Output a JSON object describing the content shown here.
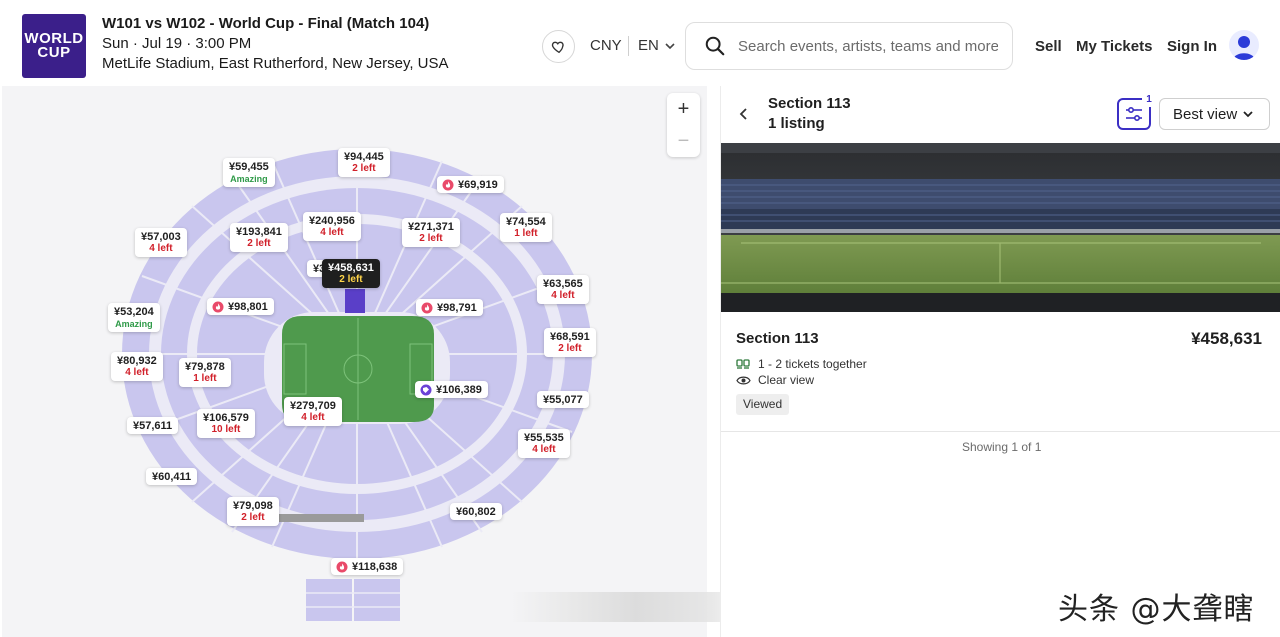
{
  "event": {
    "title": "W101 vs W102 - World Cup - Final (Match 104)",
    "datetime": "Sun · Jul 19 · 3:00 PM",
    "venue": "MetLife Stadium, East Rutherford, New Jersey, USA",
    "logo_line1": "WORLD",
    "logo_line2": "CUP"
  },
  "header": {
    "currency": "CNY",
    "language": "EN",
    "search_placeholder": "Search events, artists, teams and more",
    "nav": {
      "sell": "Sell",
      "my_tickets": "My Tickets",
      "sign_in": "Sign In"
    }
  },
  "map": {
    "zoom_in": "+",
    "zoom_out": "−",
    "pins": [
      {
        "price": "¥59,455",
        "sub": "Amazing"
      },
      {
        "price": "¥94,445",
        "sub": "2 left"
      },
      {
        "price": "¥69,919",
        "sub": ""
      },
      {
        "price": "¥240,956",
        "sub": "4 left"
      },
      {
        "price": "¥193,841",
        "sub": "2 left"
      },
      {
        "price": "¥57,003",
        "sub": "4 left"
      },
      {
        "price": "¥271,371",
        "sub": "2 left"
      },
      {
        "price": "¥74,554",
        "sub": "1 left"
      },
      {
        "price": "¥458,631",
        "sub": "2 left"
      },
      {
        "price": "¥63,565",
        "sub": "4 left"
      },
      {
        "price": "¥98,801",
        "sub": ""
      },
      {
        "price": "¥98,791",
        "sub": ""
      },
      {
        "price": "¥53,204",
        "sub": "Amazing"
      },
      {
        "price": "¥68,591",
        "sub": "2 left"
      },
      {
        "price": "¥80,932",
        "sub": "4 left"
      },
      {
        "price": "¥79,878",
        "sub": "1 left"
      },
      {
        "price": "¥106,389",
        "sub": ""
      },
      {
        "price": "¥55,077",
        "sub": ""
      },
      {
        "price": "¥279,709",
        "sub": "4 left"
      },
      {
        "price": "¥106,579",
        "sub": "10 left"
      },
      {
        "price": "¥57,611",
        "sub": ""
      },
      {
        "price": "¥55,535",
        "sub": "4 left"
      },
      {
        "price": "¥60,411",
        "sub": ""
      },
      {
        "price": "¥79,098",
        "sub": "2 left"
      },
      {
        "price": "¥60,802",
        "sub": ""
      },
      {
        "price": "¥118,638",
        "sub": ""
      }
    ],
    "partial_pin": "¥3"
  },
  "panel": {
    "section_title": "Section 113",
    "listing_count": "1 listing",
    "filter_count": "1",
    "sort_label": "Best view",
    "card": {
      "section": "Section 113",
      "price": "¥458,631",
      "tickets": "1 - 2 tickets together",
      "view": "Clear view",
      "badge": "Viewed"
    },
    "showing": "Showing 1 of 1"
  },
  "watermark": "头条 @大聋瞎",
  "colors": {
    "brand_purple": "#3b1f8a",
    "accent": "#3b2fc4",
    "seat_lavender": "#c9c6ee",
    "field_green": "#4f9a4d",
    "alert_red": "#d1202a",
    "amazing_green": "#2f9a48"
  }
}
